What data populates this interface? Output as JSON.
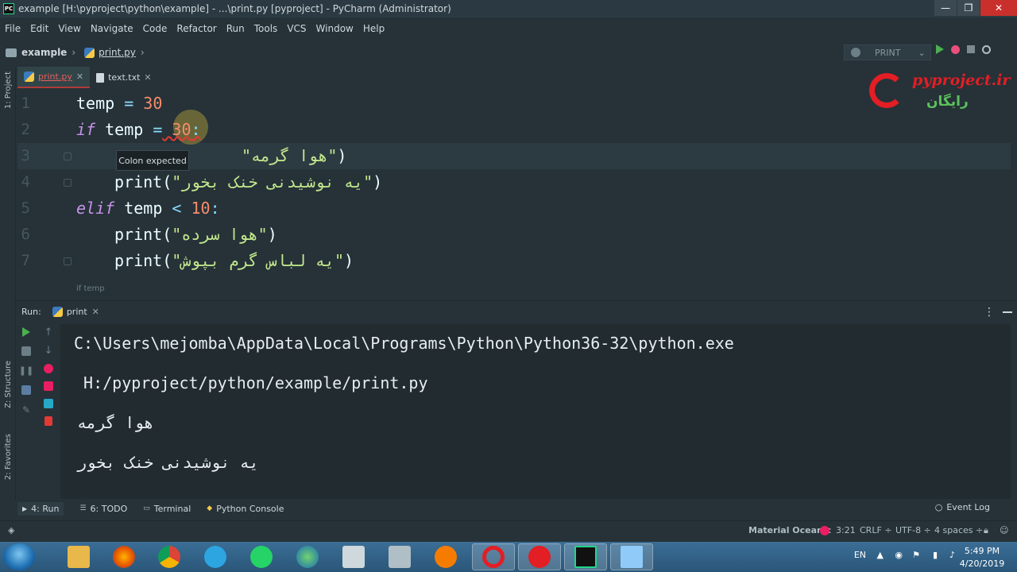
{
  "window": {
    "title": "example [H:\\pyproject\\python\\example] - ...\\print.py [pyproject] - PyCharm (Administrator)",
    "app_icon_text": "PC",
    "controls": [
      "—",
      "❐",
      "✕"
    ]
  },
  "menu": [
    "File",
    "Edit",
    "View",
    "Navigate",
    "Code",
    "Refactor",
    "Run",
    "Tools",
    "VCS",
    "Window",
    "Help"
  ],
  "navbar": {
    "project": "example",
    "file": "print.py",
    "run_config": "PRINT"
  },
  "left_strip": {
    "project_label": "1: Project",
    "structure_label": "Z: Structure",
    "favorites_label": "2: Favorites"
  },
  "tabs": [
    {
      "label": "print.py",
      "active": true
    },
    {
      "label": "text.txt",
      "active": false
    }
  ],
  "logo": {
    "text": "pyproject.ir",
    "subtitle": "رایگان"
  },
  "editor": {
    "line_numbers": [
      "1",
      "2",
      "3",
      "4",
      "5",
      "6",
      "7"
    ],
    "lines": {
      "l1_name": "temp",
      "l1_eq": " = ",
      "l1_val": "30",
      "l2_kw": "if",
      "l2_name": " temp ",
      "l2_eq": "=",
      "l2_val": " 30",
      "l2_colon": ":",
      "l3_paren": "(",
      "l3_str": "\"هوا گرمه\"",
      "l3_close": ")",
      "l4_fn": "print",
      "l4_paren": "(",
      "l4_str": "\"یه نوشیدنی خنک بخور\"",
      "l4_close": ")",
      "l5_kw": "elif",
      "l5_name": " temp ",
      "l5_op": "<",
      "l5_val": " 10",
      "l5_colon": ":",
      "l6_fn": "print",
      "l6_paren": "(",
      "l6_str": "\"هوا سرده\"",
      "l6_close": ")",
      "l7_fn": "print",
      "l7_paren": "(",
      "l7_str": "\"یه لباس گرم بپوش\"",
      "l7_close": ")"
    },
    "tooltip": "Colon expected",
    "breadcrumb": "if temp"
  },
  "run_panel": {
    "label": "Run:",
    "tab": "print",
    "console": [
      "C:\\Users\\mejomba\\AppData\\Local\\Programs\\Python\\Python36-32\\python.exe",
      " H:/pyproject/python/example/print.py",
      "هوا گرمه",
      "یه نوشیدنی خنک بخور"
    ]
  },
  "bottom_tabs": [
    {
      "label": "4: Run",
      "active": true
    },
    {
      "label": "6: TODO",
      "active": false
    },
    {
      "label": "Terminal",
      "active": false
    },
    {
      "label": "Python Console",
      "active": false
    }
  ],
  "event_log": "Event Log",
  "status": {
    "theme": "Material Oceanic",
    "position": "3:21",
    "line_sep": "CRLF ÷",
    "encoding": "UTF-8 ÷",
    "indent": "4 spaces ÷"
  },
  "tray": {
    "lang": "EN",
    "time": "5:49 PM",
    "date": "4/20/2019"
  },
  "colors": {
    "accent": "#e95d5d",
    "keyword": "#c792ea",
    "number": "#f78c6c",
    "string": "#c3e88d",
    "operator": "#89ddff"
  }
}
